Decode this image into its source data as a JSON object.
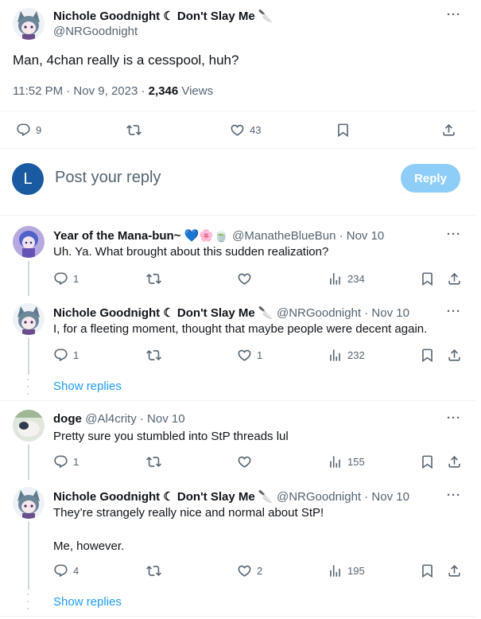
{
  "main": {
    "author_name": "Nichole Goodnight ☾ Don't Slay Me 🔪",
    "author_handle": "@NRGoodnight",
    "text": "Man, 4chan really is a cesspool, huh?",
    "time_date": "11:52 PM · Nov 9, 2023 · ",
    "views_count": "2,346",
    "views_label": " Views",
    "replies": "9",
    "likes": "43"
  },
  "reply_box": {
    "avatar_letter": "L",
    "placeholder": "Post your reply",
    "button": "Reply"
  },
  "replies": [
    {
      "name": "Year of the Mana-bun~ 💙🌸🍵",
      "handle": "@ManatheBlueBun · Nov 10",
      "text": "Uh. Ya. What brought about this sudden realization?",
      "replies": "1",
      "retweets": "",
      "likes": "",
      "views": "234"
    },
    {
      "name": "Nichole Goodnight ☾ Don't Slay Me 🔪",
      "handle": "@NRGoodnight · Nov 10",
      "text": "I, for a fleeting moment, thought that maybe people were decent again.",
      "replies": "1",
      "retweets": "",
      "likes": "1",
      "views": "232"
    },
    {
      "name": "doge",
      "handle": "@Al4crity · Nov 10",
      "text": "Pretty sure you stumbled into StP threads lul",
      "replies": "1",
      "retweets": "",
      "likes": "",
      "views": "155"
    },
    {
      "name": "Nichole Goodnight ☾ Don't Slay Me 🔪",
      "handle": "@NRGoodnight · Nov 10",
      "text": "They’re strangely really nice and normal about StP!",
      "text2": "Me, however.",
      "replies": "4",
      "retweets": "",
      "likes": "2",
      "views": "195"
    }
  ],
  "show_replies": "Show replies",
  "more": "···"
}
